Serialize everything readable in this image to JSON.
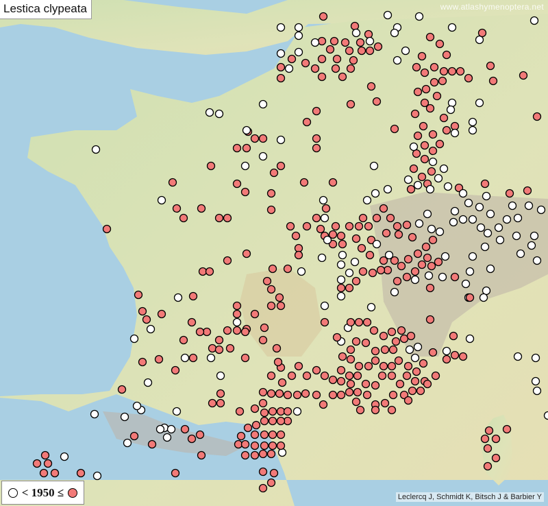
{
  "title": "Lestica clypeata",
  "watermark": "www.atlashymenoptera.net",
  "legend": {
    "year_label": "< 1950 ≤",
    "old_label": "before 1950",
    "recent_label": "1950 and after"
  },
  "credit": "Leclercq J, Schmidt K, Bitsch J & Barbier Y",
  "colors": {
    "sea": "#a9cfe3",
    "land": "#d9e2b6",
    "recent_fill": "#f27a78",
    "old_fill": "#ffffff",
    "mountain": "#bdb3a8"
  }
}
